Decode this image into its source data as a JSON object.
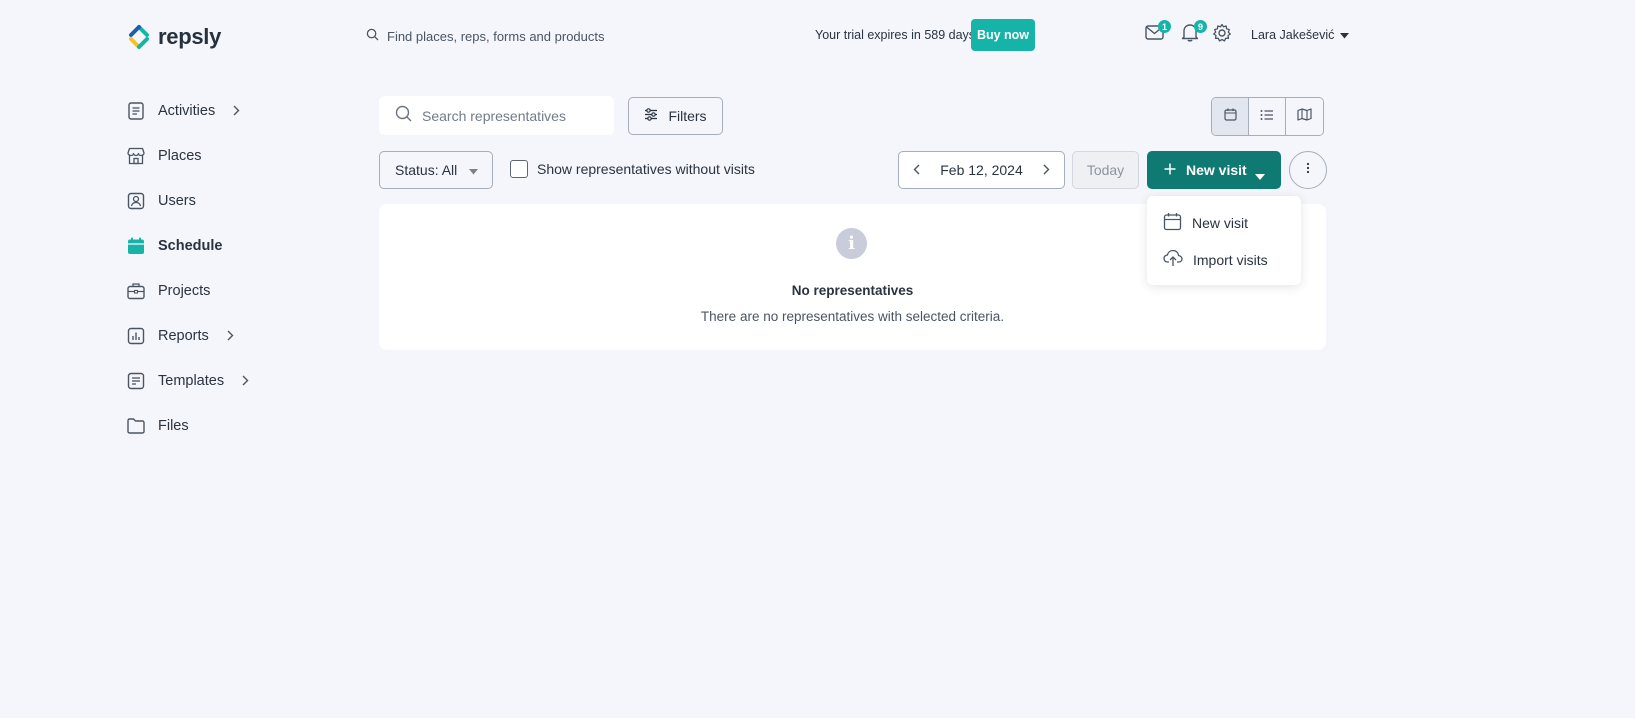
{
  "brand": {
    "name": "repsly",
    "accent": "#16b3a9",
    "primary": "#0f7a72"
  },
  "header": {
    "search_placeholder": "Find places, reps, forms and products",
    "trial_text": "Your trial expires in ",
    "trial_days": "589 days",
    "buy_label": "Buy now",
    "mail_count": "1",
    "notif_count": "9",
    "user_name": "Lara Jakešević"
  },
  "sidebar": {
    "items": [
      {
        "label": "Activities",
        "icon": "activities-icon",
        "has_chevron": true
      },
      {
        "label": "Places",
        "icon": "store-icon",
        "has_chevron": false
      },
      {
        "label": "Users",
        "icon": "user-icon",
        "has_chevron": false
      },
      {
        "label": "Schedule",
        "icon": "calendar-icon",
        "has_chevron": false,
        "active": true
      },
      {
        "label": "Projects",
        "icon": "briefcase-icon",
        "has_chevron": false
      },
      {
        "label": "Reports",
        "icon": "chart-icon",
        "has_chevron": true
      },
      {
        "label": "Templates",
        "icon": "template-icon",
        "has_chevron": true
      },
      {
        "label": "Files",
        "icon": "folder-icon",
        "has_chevron": false
      }
    ]
  },
  "toolbar": {
    "search_placeholder": "Search representatives",
    "filters_label": "Filters",
    "status_label": "Status: All",
    "checkbox_label": "Show representatives without visits",
    "date": "Feb 12, 2024",
    "today_label": "Today",
    "new_visit_label": "New visit"
  },
  "empty_state": {
    "title": "No representatives",
    "subtitle": "There are no representatives with selected criteria."
  },
  "dropdown": {
    "items": [
      {
        "label": "New visit",
        "icon": "calendar-icon"
      },
      {
        "label": "Import visits",
        "icon": "cloud-upload-icon"
      }
    ]
  }
}
